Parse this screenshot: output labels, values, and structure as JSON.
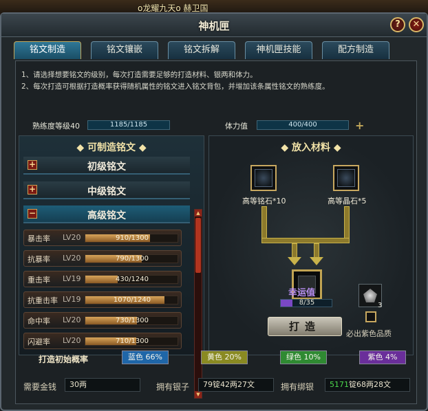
{
  "top_strip": {
    "text": "o龙耀九天o    赫卫国"
  },
  "window": {
    "title": "神机匣",
    "help_label": "?",
    "close_label": "✕"
  },
  "tabs": [
    {
      "label": "铭文制造",
      "active": true
    },
    {
      "label": "铭文镶嵌",
      "active": false
    },
    {
      "label": "铭文拆解",
      "active": false
    },
    {
      "label": "神机匣技能",
      "active": false
    },
    {
      "label": "配方制造",
      "active": false
    }
  ],
  "instructions": [
    "1、请选择想要铭文的级别，每次打造需要足够的打造材料、银两和体力。",
    "2、每次打造可根据打造概率获得随机属性的铭文进入铭文背包，并增加该条属性铭文的熟练度。"
  ],
  "stats": {
    "proficiency_label": "熟练度等级40",
    "proficiency_value": "1185/1185",
    "proficiency_fraction": 1.0,
    "stamina_label": "体力值",
    "stamina_value": "400/400",
    "stamina_fraction": 1.0,
    "plus_label": "+"
  },
  "left_pane": {
    "title": "◆ 可制造铭文 ◆",
    "categories": [
      {
        "label": "初级铭文",
        "expander": "+",
        "active": false
      },
      {
        "label": "中级铭文",
        "expander": "+",
        "active": false
      },
      {
        "label": "高级铭文",
        "expander": "−",
        "active": true
      }
    ],
    "items": [
      {
        "name": "暴击率",
        "level": "LV20",
        "progress": "910/1300",
        "fraction": 0.7
      },
      {
        "name": "抗暴率",
        "level": "LV20",
        "progress": "790/1300",
        "fraction": 0.61
      },
      {
        "name": "重击率",
        "level": "LV19",
        "progress": "430/1240",
        "fraction": 0.35
      },
      {
        "name": "抗重击率",
        "level": "LV19",
        "progress": "1070/1240",
        "fraction": 0.86
      },
      {
        "name": "命中率",
        "level": "LV20",
        "progress": "730/1300",
        "fraction": 0.56
      },
      {
        "name": "闪避率",
        "level": "LV20",
        "progress": "710/1300",
        "fraction": 0.55
      }
    ]
  },
  "right_pane": {
    "title": "◆ 放入材料 ◆",
    "material_1": "高等铭石*10",
    "material_2": "高等晶石*5",
    "luck_label": "幸运值",
    "luck_value": "8/35",
    "luck_fraction": 0.23,
    "forge_label": "打造",
    "stone_count": "3",
    "purple_label": "必出紫色品质"
  },
  "probability": {
    "title": "打造初始概率",
    "chips": [
      {
        "label": "蓝色 66%",
        "color": "#1f66a8"
      },
      {
        "label": "黄色 20%",
        "color": "#8a8a22"
      },
      {
        "label": "绿色 10%",
        "color": "#2f8a32"
      },
      {
        "label": "紫色 4%",
        "color": "#6a2e9a"
      }
    ]
  },
  "money": {
    "cost_label": "需要金钱",
    "cost_value": "30两",
    "silver_label": "拥有银子",
    "silver_value": "79锭42两27文",
    "bound_label": "拥有绑银",
    "bound_value_green": "5171",
    "bound_value_rest": "锭68两28文"
  }
}
